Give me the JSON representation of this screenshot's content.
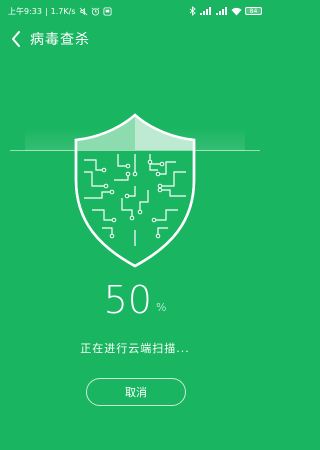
{
  "status_bar": {
    "time": "上午9:33",
    "separator": "|",
    "speed": "1.7K/s",
    "battery": "84"
  },
  "header": {
    "title": "病毒查杀"
  },
  "scan": {
    "percent": "50",
    "percent_sign": "%",
    "status": "正在进行云端扫描..."
  },
  "actions": {
    "cancel_label": "取消"
  },
  "colors": {
    "background": "#1ab561",
    "shield_fill": "#8ddcb0"
  },
  "icons": [
    "back-arrow-icon",
    "shield-icon",
    "mute-icon",
    "alarm-icon",
    "notification-icon",
    "bluetooth-icon",
    "signal-icon",
    "wifi-icon",
    "battery-icon"
  ]
}
